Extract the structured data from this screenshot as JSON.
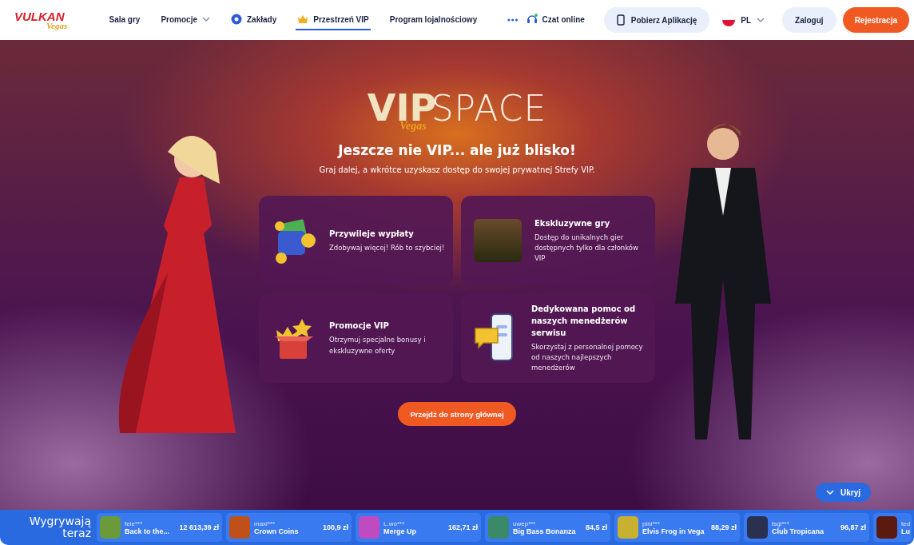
{
  "header": {
    "logo": {
      "main": "VULKAN",
      "script": "Vegas"
    },
    "nav": [
      {
        "label": "Sala gry",
        "kind": "plain",
        "selected": false
      },
      {
        "label": "Promocje",
        "kind": "dropdown",
        "selected": false
      },
      {
        "label": "Zakłady",
        "kind": "ball",
        "selected": false
      },
      {
        "label": "Przestrzeń VIP",
        "kind": "crown",
        "selected": true
      },
      {
        "label": "Program lojalnościowy",
        "kind": "plain",
        "selected": false
      }
    ],
    "chat": "Czat online",
    "app_button": "Pobierz Aplikację",
    "language": "PL",
    "login": "Zaloguj",
    "register": "Rejestracja"
  },
  "hero": {
    "logo": {
      "vip": "VIP",
      "script": "Vegas",
      "space": "SPACE"
    },
    "title": "Jeszcze nie VIP... ale już blisko!",
    "subtitle": "Graj dalej, a wkrótce uzyskasz dostęp do swojej prywatnej Strefy VIP.",
    "cards": [
      {
        "kind": "wallet",
        "title": "Przywileje wypłaty",
        "text": "Zdobywaj więcej! Rób to szybciej!"
      },
      {
        "kind": "game",
        "title": "Ekskluzywne gry",
        "text": "Dostęp do unikalnych gier dostępnych tylko dla członków VIP"
      },
      {
        "kind": "gift",
        "title": "Promocje VIP",
        "text": "Otrzymuj specjalne bonusy i ekskluzywne oferty"
      },
      {
        "kind": "phone",
        "title": "Dedykowana pomoc od naszych menedżerów serwisu",
        "text": "Skorzystaj z personalnej pomocy od naszych najlepszych menedżerów"
      }
    ],
    "cta": "Przejdź do strony głównej",
    "hide_button": "Ukryj"
  },
  "ticker": {
    "label": "Wygrywają teraz",
    "wins": [
      {
        "user": "fele***",
        "game": "Back to the...",
        "amount": "12 613,39 zł",
        "color": "#6a9a3a"
      },
      {
        "user": "maxi***",
        "game": "Crown Coins",
        "amount": "100,9 zł",
        "color": "#c0501a"
      },
      {
        "user": "L.wo***",
        "game": "Merge Up",
        "amount": "162,71 zł",
        "color": "#c04ac0"
      },
      {
        "user": "uwep***",
        "game": "Big Bass Bonanza",
        "amount": "84,5 zł",
        "color": "#3a8a6a"
      },
      {
        "user": "pini***",
        "game": "Elvis Frog in Vega",
        "amount": "88,29 zł",
        "color": "#c8b030"
      },
      {
        "user": "tsgi***",
        "game": "Club Tropicana",
        "amount": "96,87 zł",
        "color": "#2a3050"
      },
      {
        "user": "ted",
        "game": "Lu",
        "color": "#5a1a10"
      }
    ]
  }
}
